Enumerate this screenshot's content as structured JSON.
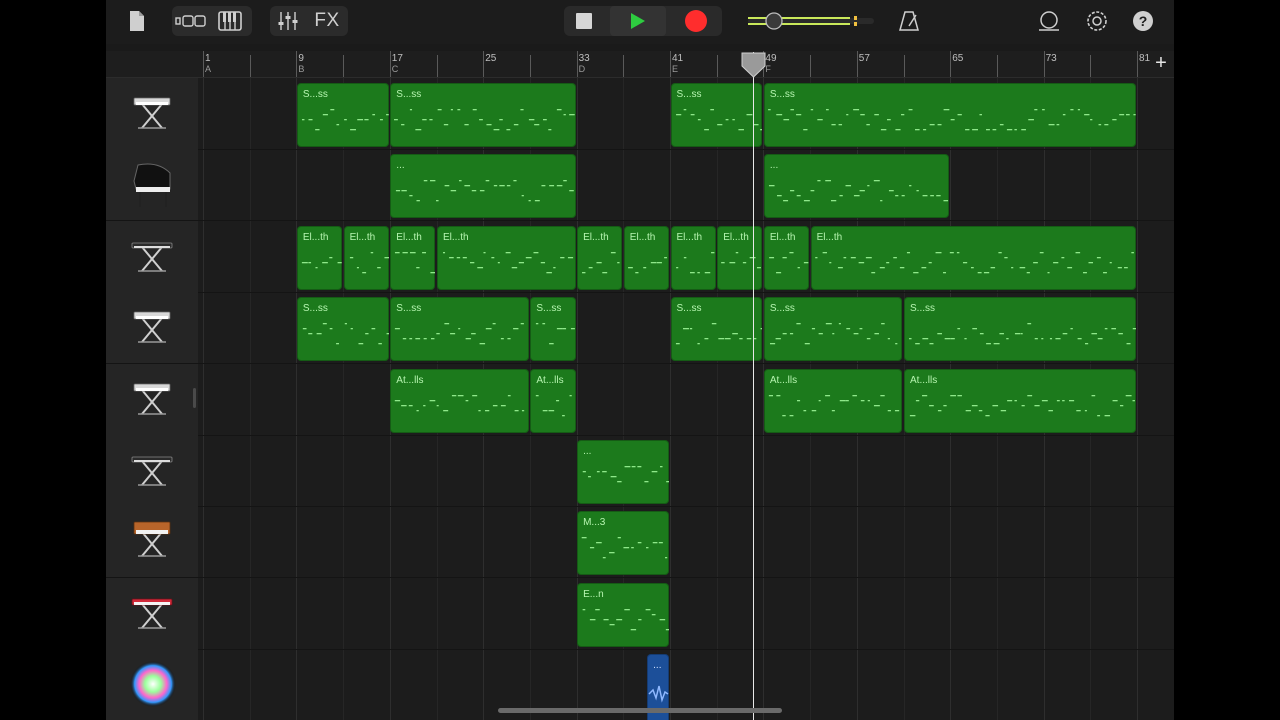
{
  "toolbar": {
    "fx_label": "FX",
    "accent_play": "#2ecc40",
    "accent_record": "#ff2d2d",
    "icons": [
      "document-icon",
      "tracks-view-icon",
      "keyboard-icon",
      "mixer-icon",
      "fx-label",
      "stop-icon",
      "play-icon",
      "record-icon",
      "master-volume-slider",
      "metronome-icon",
      "loop-icon",
      "settings-icon",
      "help-icon"
    ],
    "master_volume": 0.25
  },
  "ruler": {
    "bars": [
      {
        "label": "1",
        "section": "A"
      },
      {
        "label": "9",
        "section": "B"
      },
      {
        "label": "17",
        "section": "C"
      },
      {
        "label": "25",
        "section": ""
      },
      {
        "label": "33",
        "section": "D"
      },
      {
        "label": "41",
        "section": "E"
      },
      {
        "label": "49",
        "section": "F"
      },
      {
        "label": "57",
        "section": ""
      },
      {
        "label": "65",
        "section": ""
      },
      {
        "label": "73",
        "section": ""
      },
      {
        "label": "81",
        "section": ""
      }
    ],
    "add_label": "+"
  },
  "playhead_bar": 49,
  "tracks": [
    {
      "instrument": "synth-keyboard-icon",
      "regions": [
        {
          "name": "S...ss",
          "start": 9,
          "end": 17
        },
        {
          "name": "S...ss",
          "start": 17,
          "end": 33
        },
        {
          "name": "S...ss",
          "start": 41,
          "end": 49
        },
        {
          "name": "S...ss",
          "start": 49,
          "end": 81
        }
      ]
    },
    {
      "instrument": "grand-piano-icon",
      "regions": [
        {
          "name": "...",
          "start": 17,
          "end": 33
        },
        {
          "name": "...",
          "start": 49,
          "end": 65
        }
      ]
    },
    {
      "instrument": "electric-keyboard-icon",
      "regions": [
        {
          "name": "El...th",
          "start": 9,
          "end": 13
        },
        {
          "name": "El...th",
          "start": 13,
          "end": 17
        },
        {
          "name": "El...th",
          "start": 17,
          "end": 21
        },
        {
          "name": "El...th",
          "start": 21,
          "end": 33
        },
        {
          "name": "El...th",
          "start": 33,
          "end": 37
        },
        {
          "name": "El...th",
          "start": 37,
          "end": 41
        },
        {
          "name": "El...th",
          "start": 41,
          "end": 45
        },
        {
          "name": "El...th",
          "start": 45,
          "end": 49
        },
        {
          "name": "El...th",
          "start": 49,
          "end": 53
        },
        {
          "name": "El...th",
          "start": 53,
          "end": 81
        }
      ]
    },
    {
      "instrument": "synth-keyboard-icon",
      "regions": [
        {
          "name": "S...ss",
          "start": 9,
          "end": 17
        },
        {
          "name": "S...ss",
          "start": 17,
          "end": 29
        },
        {
          "name": "S...ss",
          "start": 29,
          "end": 33
        },
        {
          "name": "S...ss",
          "start": 41,
          "end": 49
        },
        {
          "name": "S...ss",
          "start": 49,
          "end": 61
        },
        {
          "name": "S...ss",
          "start": 61,
          "end": 81
        }
      ]
    },
    {
      "instrument": "synth-keyboard-icon",
      "regions": [
        {
          "name": "At...lls",
          "start": 17,
          "end": 29
        },
        {
          "name": "At...lls",
          "start": 29,
          "end": 33
        },
        {
          "name": "At...lls",
          "start": 49,
          "end": 61
        },
        {
          "name": "At...lls",
          "start": 61,
          "end": 81
        }
      ]
    },
    {
      "instrument": "electric-keyboard-icon",
      "regions": [
        {
          "name": "...",
          "start": 33,
          "end": 41
        }
      ]
    },
    {
      "instrument": "vintage-synth-icon",
      "regions": [
        {
          "name": "M...3",
          "start": 33,
          "end": 41
        }
      ]
    },
    {
      "instrument": "red-stage-piano-icon",
      "regions": [
        {
          "name": "E...n",
          "start": 33,
          "end": 41
        }
      ]
    },
    {
      "instrument": "sparkle-sampler-icon",
      "regions": [
        {
          "name": "...",
          "start": 39,
          "end": 41,
          "audio": true
        }
      ]
    }
  ]
}
